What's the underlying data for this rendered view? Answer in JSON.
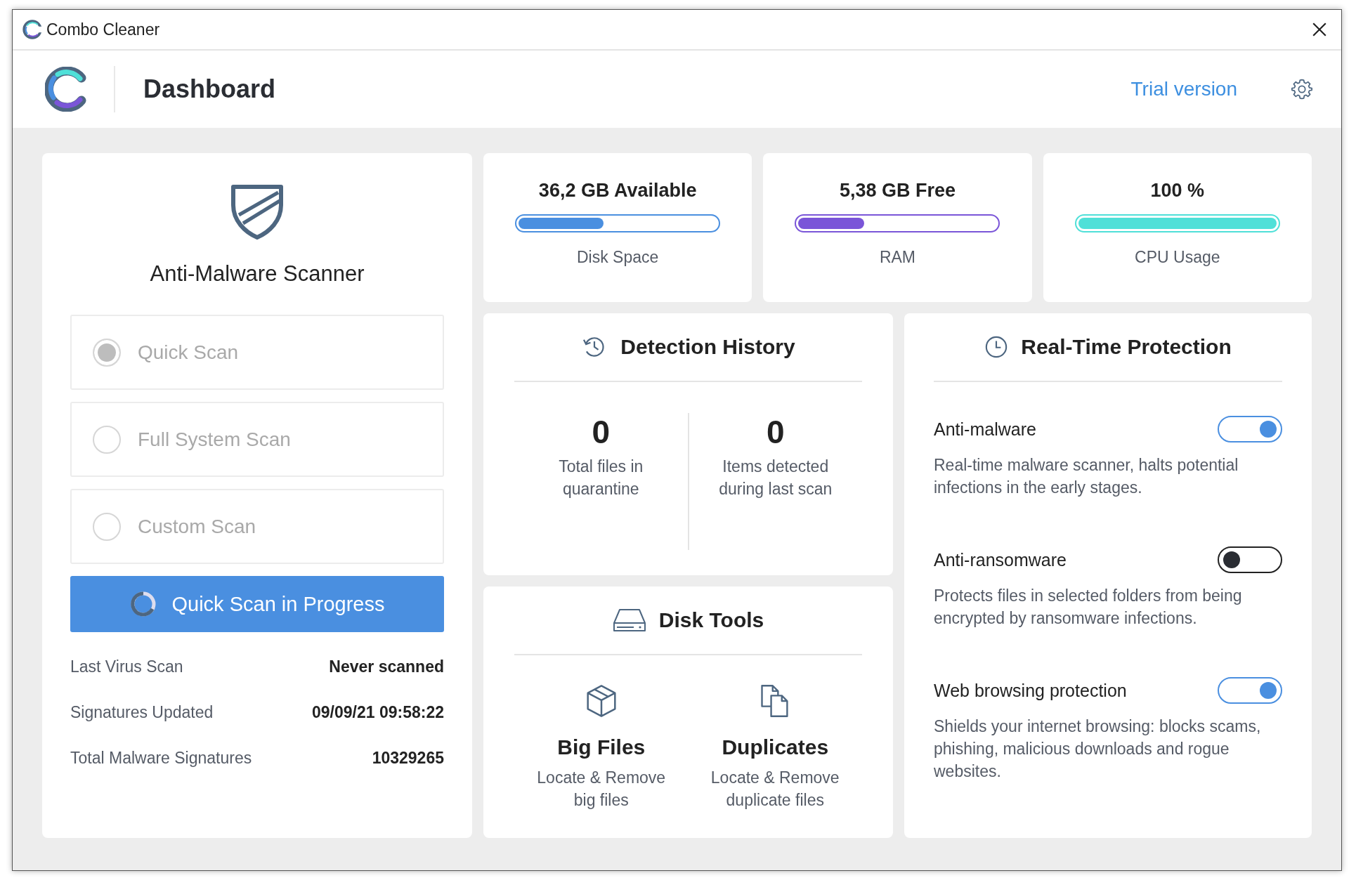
{
  "window": {
    "title": "Combo Cleaner"
  },
  "header": {
    "title": "Dashboard",
    "trial_link": "Trial version"
  },
  "scanner": {
    "title": "Anti-Malware Scanner",
    "options": [
      {
        "label": "Quick Scan",
        "selected": true,
        "disabled": true
      },
      {
        "label": "Full System Scan",
        "selected": false,
        "disabled": true
      },
      {
        "label": "Custom Scan",
        "selected": false,
        "disabled": true
      }
    ],
    "scan_button": {
      "label": "Quick Scan in Progress",
      "in_progress": true
    },
    "info": [
      {
        "label": "Last Virus Scan",
        "value": "Never scanned"
      },
      {
        "label": "Signatures Updated",
        "value": "09/09/21 09:58:22"
      },
      {
        "label": "Total Malware Signatures",
        "value": "10329265"
      }
    ]
  },
  "meters": [
    {
      "value": "36,2 GB Available",
      "label": "Disk Space",
      "level": 0.43,
      "color": "#4a8fe0"
    },
    {
      "value": "5,38 GB Free",
      "label": "RAM",
      "level": 0.33,
      "color": "#7a55d8"
    },
    {
      "value": "100 %",
      "label": "CPU Usage",
      "level": 1.0,
      "color": "#4fe0d8"
    }
  ],
  "detection_history": {
    "title": "Detection History",
    "stats": [
      {
        "count": "0",
        "label": "Total files in quarantine"
      },
      {
        "count": "0",
        "label": "Items detected during last scan"
      }
    ]
  },
  "disk_tools": {
    "title": "Disk Tools",
    "tools": [
      {
        "kind": "big_files",
        "title": "Big Files",
        "description": "Locate & Remove big files"
      },
      {
        "kind": "duplicates",
        "title": "Duplicates",
        "description": "Locate & Remove duplicate files"
      }
    ]
  },
  "real_time_protection": {
    "title": "Real-Time Protection",
    "items": [
      {
        "name": "Anti-malware",
        "on": true,
        "description": "Real-time malware scanner, halts potential infections in the early stages."
      },
      {
        "name": "Anti-ransomware",
        "on": false,
        "description": "Protects files in selected folders from being encrypted by ransomware infections."
      },
      {
        "name": "Web browsing protection",
        "on": true,
        "description": "Shields your internet browsing: blocks scams, phishing, malicious downloads and rogue websites."
      }
    ]
  }
}
